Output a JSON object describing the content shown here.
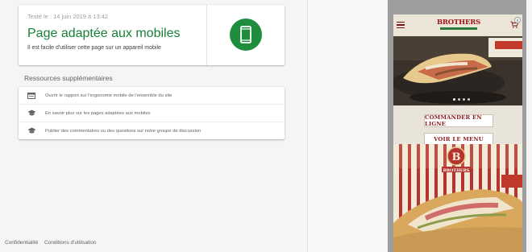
{
  "result": {
    "tested_label": "Testé le : 14 juin 2019 à 13:42",
    "title": "Page adaptée aux mobiles",
    "subtitle": "Il est facile d'utiliser cette page sur un appareil mobile"
  },
  "resources": {
    "title": "Ressources supplémentaires",
    "items": [
      {
        "icon": "report-icon",
        "label": "Ouvrir le rapport sur l'ergonomie mobile de l'ensemble du site"
      },
      {
        "icon": "school-icon",
        "label": "En savoir plus sur les pages adaptées aux mobiles"
      },
      {
        "icon": "school-icon",
        "label": "Publier des commentaires ou des questions sur notre groupe de discussion"
      }
    ]
  },
  "footer": {
    "privacy": "Confidentialité",
    "terms": "Conditions d'utilisation"
  },
  "preview": {
    "logo": "BROTHERS",
    "cart_count": "0",
    "primary_cta": "COMMANDER EN LIGNE",
    "secondary_cta": "VOIR LE MENU",
    "promo_logo_letter": "B",
    "promo_logo_text": "BROTHERS"
  },
  "colors": {
    "success_green": "#188038",
    "badge_green": "#1e8e3e",
    "brand_red": "#a1151a"
  }
}
